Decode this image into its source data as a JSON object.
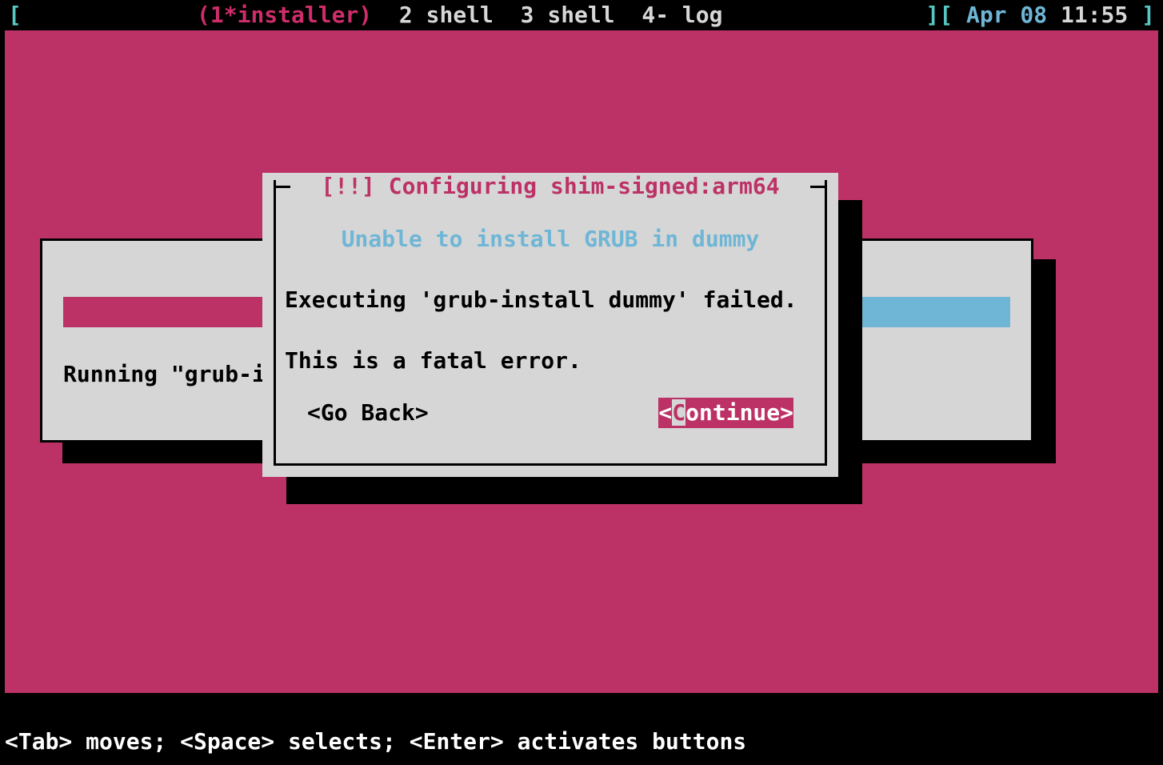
{
  "status": {
    "left_bracket": "[",
    "right_bracket_open": "][",
    "right_bracket_close": "]",
    "active": "(1*installer)",
    "tabs": [
      {
        "label": "2 shell"
      },
      {
        "label": "3 shell"
      },
      {
        "label": "4- log"
      }
    ],
    "date": "Apr 08",
    "time": "11:55"
  },
  "background_dialog": {
    "running_text": "Running \"grub-i"
  },
  "dialog": {
    "title": "[!!] Configuring shim-signed:arm64",
    "subtitle": "Unable to install GRUB in dummy",
    "line1": "Executing 'grub-install dummy' failed.",
    "line2": "This is a fatal error.",
    "buttons": {
      "back": "<Go Back>",
      "cont_open": "<",
      "cont_hotkey": "C",
      "cont_rest": "ontinue>"
    }
  },
  "help": "<Tab> moves; <Space> selects; <Enter> activates buttons"
}
